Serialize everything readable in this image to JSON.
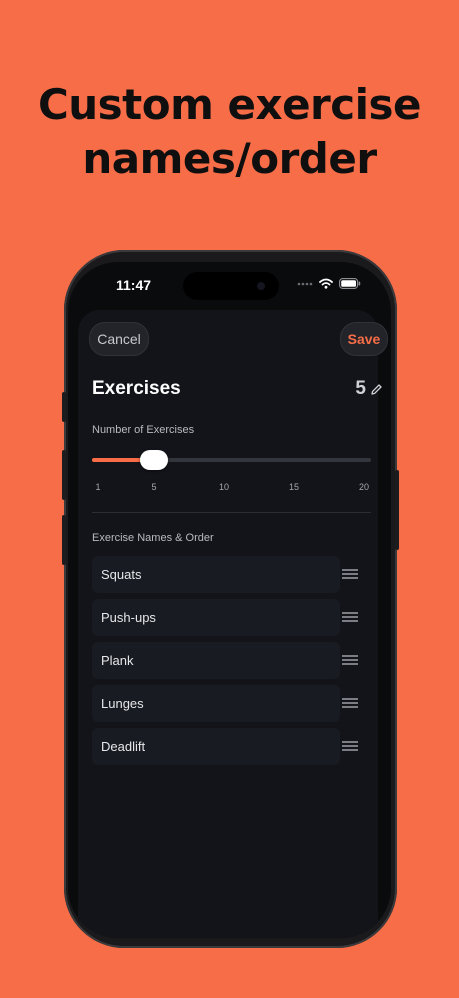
{
  "headline": {
    "line1": "Custom exercise",
    "line2": "names/order"
  },
  "status_bar": {
    "time": "11:47"
  },
  "toolbar": {
    "cancel_label": "Cancel",
    "save_label": "Save"
  },
  "exercises_section": {
    "title": "Exercises",
    "count": "5",
    "slider_label": "Number of Exercises",
    "slider_value": 5,
    "slider_min": 1,
    "slider_max": 20,
    "ticks": [
      "1",
      "5",
      "10",
      "15",
      "20"
    ]
  },
  "list": {
    "header": "Exercise Names & Order",
    "items": [
      "Squats",
      "Push-ups",
      "Plank",
      "Lunges",
      "Deadlift"
    ]
  },
  "colors": {
    "accent": "#F76D47",
    "background": "#F76D47",
    "sheet": "#13141a"
  },
  "icons": {
    "edit": "pencil-icon",
    "reorder": "drag-handle-icon"
  }
}
